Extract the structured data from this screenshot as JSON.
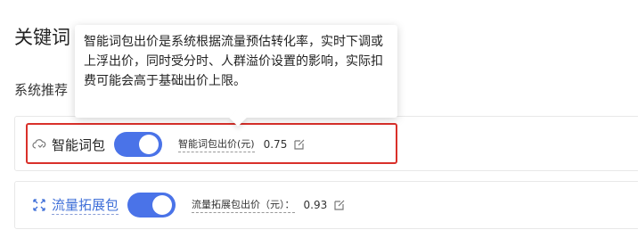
{
  "header": {
    "title_visible": "关键词",
    "subtitle_visible": "系统推荐"
  },
  "tooltip": {
    "text": "智能词包出价是系统根据流量预估转化率，实时下调或上浮出价，同时受分时、人群溢价设置的影响，实际扣费可能会高于基础出价上限。"
  },
  "packages": [
    {
      "icon": "cloud-smart-icon",
      "name": "智能词包",
      "enabled": true,
      "bid_label": "智能词包出价(元)",
      "bid_value": "0.75"
    },
    {
      "icon": "expand-arrows-icon",
      "name": "流量拓展包",
      "enabled": true,
      "bid_label": "流量拓展包出价（元）：",
      "bid_value": "0.93"
    }
  ],
  "colors": {
    "switch_on": "#4a73e8",
    "highlight_border": "#d9302a",
    "link": "#3f6fd8"
  }
}
